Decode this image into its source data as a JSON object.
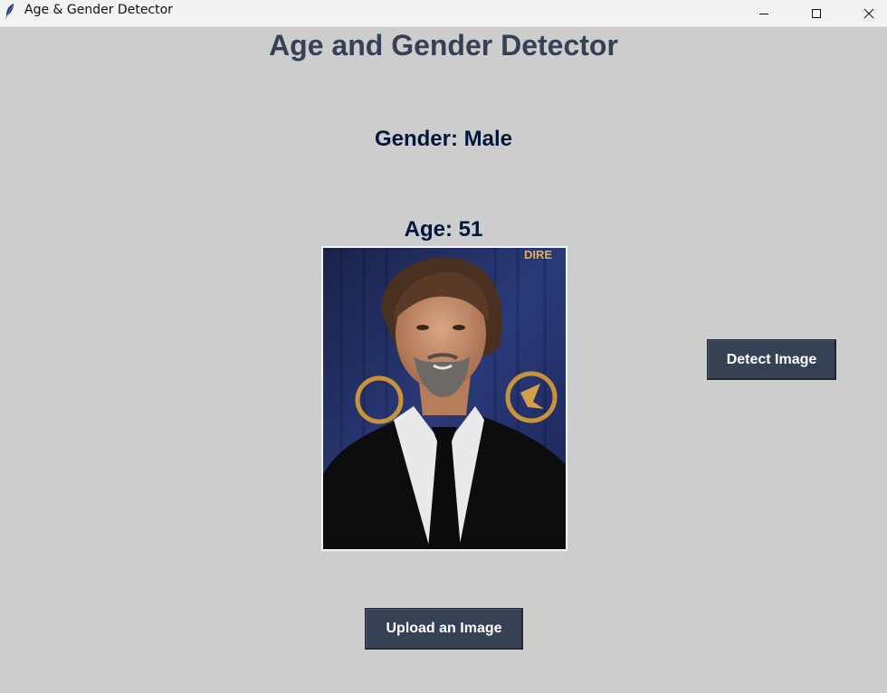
{
  "window": {
    "title": "Age & Gender Detector",
    "controls": [
      "minimize-icon",
      "maximize-icon",
      "close-icon"
    ]
  },
  "app": {
    "heading": "Age and Gender Detector",
    "gender_label": "Gender: Male",
    "age_label": "Age: 51"
  },
  "image": {
    "description_icon": "portrait-photo",
    "backdrop_text": "DIRE"
  },
  "buttons": {
    "detect_label": "Detect Image",
    "upload_label": "Upload an Image"
  },
  "colors": {
    "background": "#cdcdcd",
    "heading": "#364156",
    "label": "#011638",
    "button_bg": "#364156",
    "button_text": "#ffffff"
  }
}
